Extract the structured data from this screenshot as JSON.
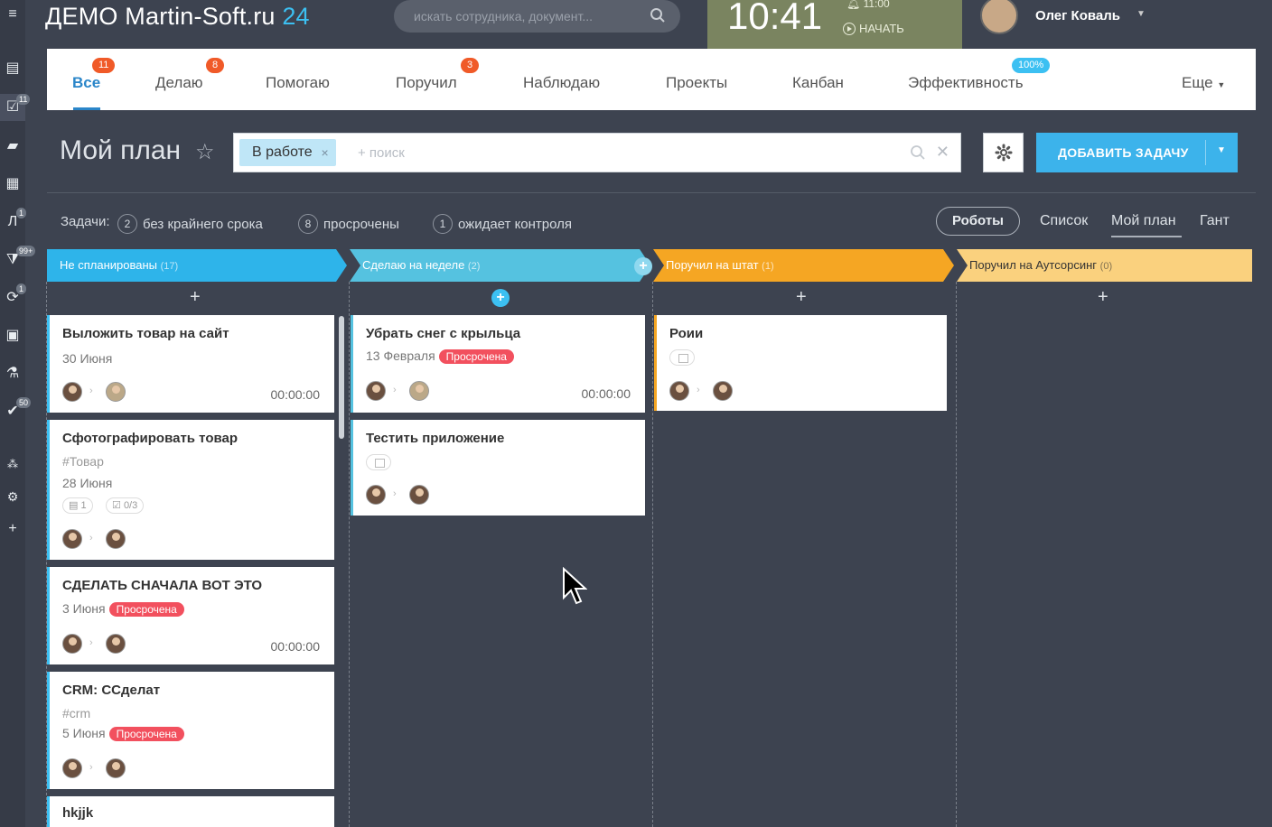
{
  "header": {
    "logo_text": "ДЕМО Martin-Soft.ru",
    "logo_num": "24",
    "search_placeholder": "искать сотрудника, документ...",
    "clock_time": "10:41",
    "clock_alarm": "11:00",
    "clock_start": "НАЧАТЬ",
    "user_name": "Олег Коваль"
  },
  "rail": {
    "badges": [
      "11",
      "1",
      "99+",
      "1",
      "50"
    ]
  },
  "tabs": [
    {
      "label": "Все",
      "badge": "11"
    },
    {
      "label": "Делаю",
      "badge": "8"
    },
    {
      "label": "Помогаю",
      "badge": ""
    },
    {
      "label": "Поручил",
      "badge": "3"
    },
    {
      "label": "Наблюдаю",
      "badge": ""
    },
    {
      "label": "Проекты",
      "badge": ""
    },
    {
      "label": "Канбан",
      "badge": ""
    },
    {
      "label": "Эффективность",
      "badge": "100%"
    },
    {
      "label": "Еще",
      "badge": ""
    }
  ],
  "page": {
    "title": "Мой план",
    "filter_chip": "В работе",
    "filter_search": "+ поиск",
    "add_button": "ДОБАВИТЬ ЗАДАЧУ"
  },
  "counters": {
    "label": "Задачи:",
    "items": [
      {
        "count": "2",
        "label": "без крайнего срока"
      },
      {
        "count": "8",
        "label": "просрочены"
      },
      {
        "count": "1",
        "label": "ожидает контроля"
      }
    ]
  },
  "views": {
    "robots": "Роботы",
    "list": "Список",
    "my_plan": "Мой план",
    "gantt": "Гант"
  },
  "columns": [
    {
      "title": "Не спланированы",
      "count": "(17)",
      "color": "#2eb4ea"
    },
    {
      "title": "Сделаю на неделе",
      "count": "(2)",
      "color": "#55c2e0"
    },
    {
      "title": "Поручил на штат",
      "count": "(1)",
      "color": "#f5a623"
    },
    {
      "title": "Поручил на Аутсорсинг",
      "count": "(0)",
      "color": "#fad17e"
    }
  ],
  "cards": {
    "c1": {
      "title": "Выложить товар на сайт",
      "date": "30 Июня",
      "timer": "00:00:00"
    },
    "c2": {
      "title": "Сфотографировать товар",
      "tag": "#Товар",
      "date": "28 Июня",
      "comments": "1",
      "checklist": "0/3"
    },
    "c3": {
      "title": "СДЕЛАТЬ СНАЧАЛА ВОТ ЭТО",
      "date": "3 Июня",
      "status": "Просрочена",
      "timer": "00:00:00"
    },
    "c4": {
      "title": "CRM: ССделат",
      "tag": "#crm",
      "date": "5 Июня",
      "status": "Просрочена"
    },
    "c5": {
      "title": "hkjjk"
    },
    "d1": {
      "title": "Убрать снег с крыльца",
      "date": "13 Февраля",
      "status": "Просрочена",
      "timer": "00:00:00"
    },
    "d2": {
      "title": "Тестить приложение"
    },
    "e1": {
      "title": "Роии"
    }
  }
}
